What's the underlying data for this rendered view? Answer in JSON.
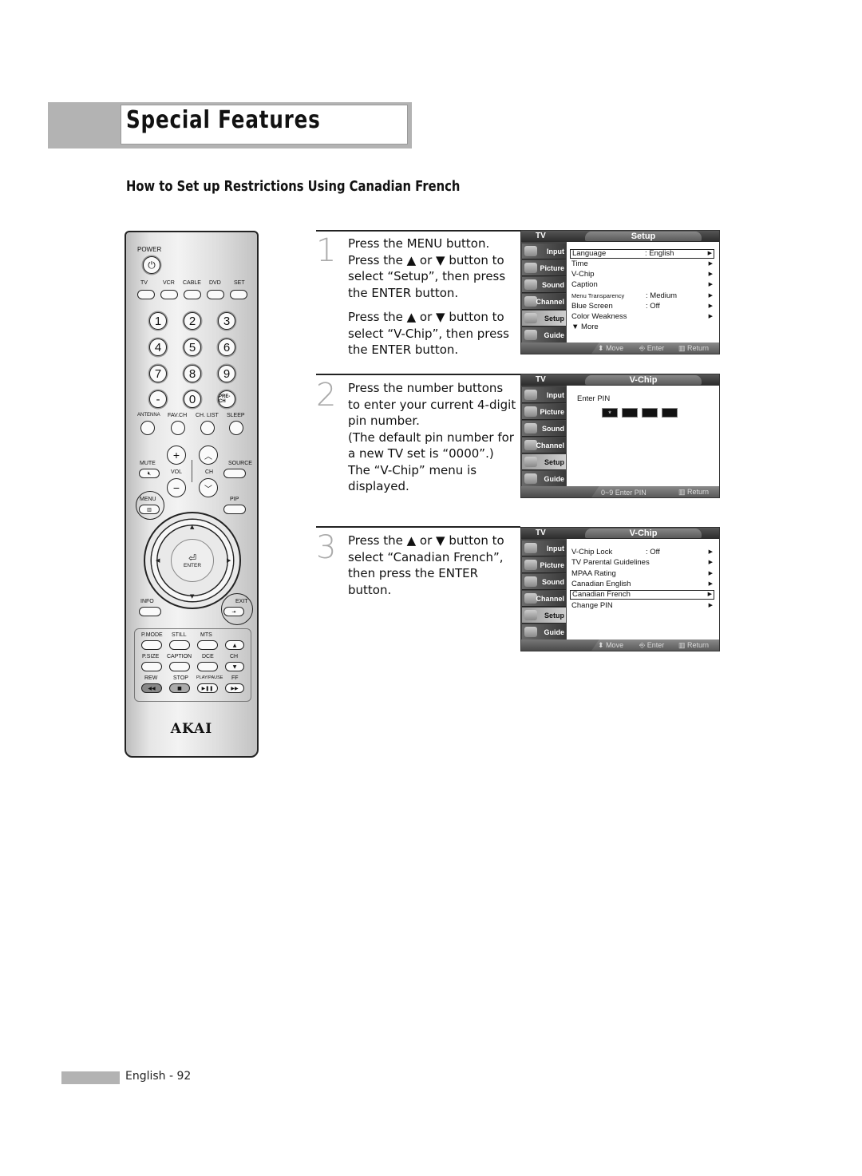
{
  "header": {
    "section_title": "Special Features",
    "page_title": "How to Set up Restrictions Using Canadian French"
  },
  "remote": {
    "brand": "AKAI",
    "power_label": "POWER",
    "source_buttons": [
      "TV",
      "VCR",
      "CABLE",
      "DVD",
      "SET"
    ],
    "number_keys": [
      "1",
      "2",
      "3",
      "4",
      "5",
      "6",
      "7",
      "8",
      "9",
      "-",
      "0",
      "PRE-CH"
    ],
    "function_labels": [
      "ANTENNA",
      "FAV.CH",
      "CH. LIST",
      "SLEEP"
    ],
    "mute_label": "MUTE",
    "vol_label": "VOL",
    "ch_label": "CH",
    "source_label": "SOURCE",
    "menu_label": "MENU",
    "pip_label": "PIP",
    "enter_label": "ENTER",
    "info_label": "INFO",
    "exit_label": "EXIT",
    "bottom_row1": [
      "P.MODE",
      "STILL",
      "MTS"
    ],
    "bottom_row2": [
      "P.SIZE",
      "CAPTION",
      "DCE",
      "CH"
    ],
    "bottom_row3": [
      "REW",
      "STOP",
      "PLAY/PAUSE",
      "FF"
    ]
  },
  "steps": [
    {
      "number": "1",
      "paragraphs": [
        "Press the MENU button. Press the ▲ or ▼ button to select “Setup”, then press the ENTER button.",
        "Press the ▲ or ▼ button to select “V-Chip”, then press the ENTER button."
      ]
    },
    {
      "number": "2",
      "paragraphs": [
        "Press the number buttons to enter your current 4-digit pin number.",
        "(The default pin number for a new TV set is “0000”.)",
        "The “V-Chip” menu is displayed."
      ]
    },
    {
      "number": "3",
      "paragraphs": [
        "Press the ▲ or ▼ button to select “Canadian French”, then press the ENTER button."
      ]
    }
  ],
  "osd": {
    "tv_label": "TV",
    "side_items": [
      "Input",
      "Picture",
      "Sound",
      "Channel",
      "Setup",
      "Guide"
    ],
    "active_side_item": "Setup",
    "screens": [
      {
        "title": "Setup",
        "rows": [
          {
            "label": "Language",
            "value": ": English",
            "selected": true
          },
          {
            "label": "Time",
            "value": ""
          },
          {
            "label": "V-Chip",
            "value": ""
          },
          {
            "label": "Caption",
            "value": ""
          },
          {
            "label": "Menu Transparency",
            "value": ": Medium"
          },
          {
            "label": "Blue Screen",
            "value": ": Off"
          },
          {
            "label": "Color Weakness",
            "value": ""
          },
          {
            "label": "▼ More",
            "value": ""
          }
        ],
        "hints": [
          "Move",
          "Enter",
          "Return"
        ]
      },
      {
        "title": "V-Chip",
        "prompt": "Enter PIN",
        "pin_digits": [
          "*",
          "",
          "",
          ""
        ],
        "hints": [
          "0~9 Enter PIN",
          "Return"
        ]
      },
      {
        "title": "V-Chip",
        "rows": [
          {
            "label": "V-Chip Lock",
            "value": ": Off"
          },
          {
            "label": "TV Parental Guidelines",
            "value": ""
          },
          {
            "label": "MPAA Rating",
            "value": ""
          },
          {
            "label": "Canadian English",
            "value": ""
          },
          {
            "label": "Canadian French",
            "value": "",
            "selected": true
          },
          {
            "label": "Change PIN",
            "value": ""
          }
        ],
        "hints": [
          "Move",
          "Enter",
          "Return"
        ]
      }
    ]
  },
  "footer": {
    "page_label": "English - 92"
  }
}
